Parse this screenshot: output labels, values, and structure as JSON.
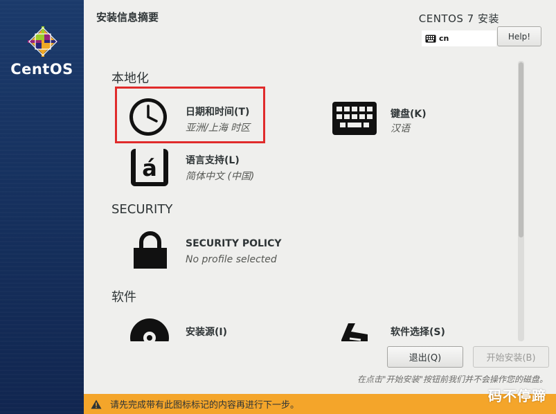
{
  "sidebar": {
    "logo_text": "CentOS"
  },
  "header": {
    "title": "安装信息摘要",
    "product": "CENTOS 7 安装",
    "keyboard_layout": "cn",
    "help_label": "Help!"
  },
  "sections": {
    "localization": "本地化",
    "security": "SECURITY",
    "software": "软件"
  },
  "spokes": {
    "datetime": {
      "label": "日期和时间(T)",
      "status": "亚洲/上海 时区",
      "icon": "clock-icon"
    },
    "keyboard": {
      "label": "键盘(K)",
      "status": "汉语",
      "icon": "keyboard-icon"
    },
    "language": {
      "label": "语言支持(L)",
      "status": "简体中文 (中国)",
      "icon": "language-icon"
    },
    "security_policy": {
      "label": "SECURITY POLICY",
      "status": "No profile selected",
      "icon": "lock-icon"
    },
    "install_source": {
      "label": "安装源(I)",
      "icon": "disc-icon"
    },
    "software_selection": {
      "label": "软件选择(S)",
      "icon": "package-icon"
    }
  },
  "buttons": {
    "quit": "退出(Q)",
    "begin": "开始安装(B)"
  },
  "hint": "在点击\"开始安装\"按钮前我们并不会操作您的磁盘。",
  "warning": "请先完成带有此图标标记的内容再进行下一步。",
  "watermark": "码不停蹄",
  "colors": {
    "sidebar": "#1b3a6b",
    "warning_bar": "#f4a52a",
    "highlight": "#e02b2b"
  }
}
